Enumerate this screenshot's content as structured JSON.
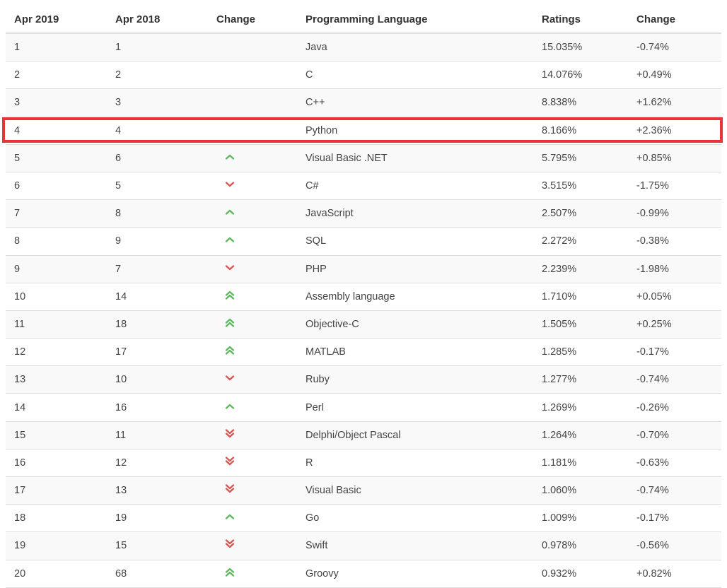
{
  "table": {
    "headers": [
      "Apr 2019",
      "Apr 2018",
      "Change",
      "Programming Language",
      "Ratings",
      "Change"
    ],
    "rows": [
      {
        "apr2019": "1",
        "apr2018": "1",
        "trend": "none",
        "language": "Java",
        "rating": "15.035%",
        "change": "-0.74%"
      },
      {
        "apr2019": "2",
        "apr2018": "2",
        "trend": "none",
        "language": "C",
        "rating": "14.076%",
        "change": "+0.49%"
      },
      {
        "apr2019": "3",
        "apr2018": "3",
        "trend": "none",
        "language": "C++",
        "rating": "8.838%",
        "change": "+1.62%"
      },
      {
        "apr2019": "4",
        "apr2018": "4",
        "trend": "none",
        "language": "Python",
        "rating": "8.166%",
        "change": "+2.36%"
      },
      {
        "apr2019": "5",
        "apr2018": "6",
        "trend": "up",
        "language": "Visual Basic .NET",
        "rating": "5.795%",
        "change": "+0.85%"
      },
      {
        "apr2019": "6",
        "apr2018": "5",
        "trend": "down",
        "language": "C#",
        "rating": "3.515%",
        "change": "-1.75%"
      },
      {
        "apr2019": "7",
        "apr2018": "8",
        "trend": "up",
        "language": "JavaScript",
        "rating": "2.507%",
        "change": "-0.99%"
      },
      {
        "apr2019": "8",
        "apr2018": "9",
        "trend": "up",
        "language": "SQL",
        "rating": "2.272%",
        "change": "-0.38%"
      },
      {
        "apr2019": "9",
        "apr2018": "7",
        "trend": "down",
        "language": "PHP",
        "rating": "2.239%",
        "change": "-1.98%"
      },
      {
        "apr2019": "10",
        "apr2018": "14",
        "trend": "double-up",
        "language": "Assembly language",
        "rating": "1.710%",
        "change": "+0.05%"
      },
      {
        "apr2019": "11",
        "apr2018": "18",
        "trend": "double-up",
        "language": "Objective-C",
        "rating": "1.505%",
        "change": "+0.25%"
      },
      {
        "apr2019": "12",
        "apr2018": "17",
        "trend": "double-up",
        "language": "MATLAB",
        "rating": "1.285%",
        "change": "-0.17%"
      },
      {
        "apr2019": "13",
        "apr2018": "10",
        "trend": "down",
        "language": "Ruby",
        "rating": "1.277%",
        "change": "-0.74%"
      },
      {
        "apr2019": "14",
        "apr2018": "16",
        "trend": "up",
        "language": "Perl",
        "rating": "1.269%",
        "change": "-0.26%"
      },
      {
        "apr2019": "15",
        "apr2018": "11",
        "trend": "double-down",
        "language": "Delphi/Object Pascal",
        "rating": "1.264%",
        "change": "-0.70%"
      },
      {
        "apr2019": "16",
        "apr2018": "12",
        "trend": "double-down",
        "language": "R",
        "rating": "1.181%",
        "change": "-0.63%"
      },
      {
        "apr2019": "17",
        "apr2018": "13",
        "trend": "double-down",
        "language": "Visual Basic",
        "rating": "1.060%",
        "change": "-0.74%"
      },
      {
        "apr2019": "18",
        "apr2018": "19",
        "trend": "up",
        "language": "Go",
        "rating": "1.009%",
        "change": "-0.17%"
      },
      {
        "apr2019": "19",
        "apr2018": "15",
        "trend": "double-down",
        "language": "Swift",
        "rating": "0.978%",
        "change": "-0.56%"
      },
      {
        "apr2019": "20",
        "apr2018": "68",
        "trend": "double-up",
        "language": "Groovy",
        "rating": "0.932%",
        "change": "+0.82%"
      }
    ]
  },
  "colors": {
    "up": "#5cb85c",
    "down": "#d9534f",
    "highlight": "#e8333a"
  },
  "highlighted_row": 3
}
